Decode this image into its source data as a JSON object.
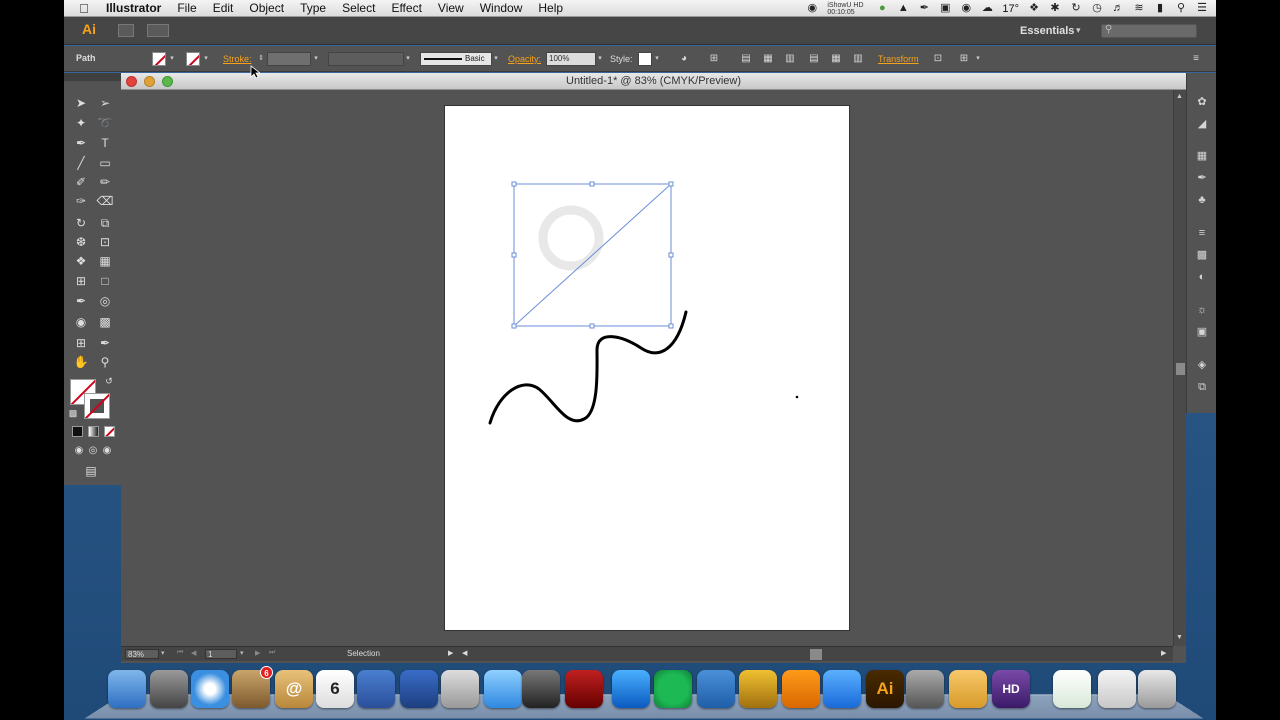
{
  "menubar": {
    "app_name": "Illustrator",
    "items": [
      "File",
      "Edit",
      "Object",
      "Type",
      "Select",
      "Effect",
      "View",
      "Window",
      "Help"
    ],
    "recorder_line1": "iShowU HD",
    "recorder_line2": "00:10:05",
    "temperature": "17°"
  },
  "appbar": {
    "logo": "Ai",
    "workspace": "Essentials"
  },
  "control_bar": {
    "selection_label": "Path",
    "stroke_label": "Stroke:",
    "brush_label": "Basic",
    "opacity_label": "Opacity:",
    "opacity_value": "100%",
    "style_label": "Style:",
    "transform_label": "Transform"
  },
  "document": {
    "title": "Untitled-1* @ 83% (CMYK/Preview)",
    "zoom": "83%",
    "artboard_number": "1",
    "status_tool": "Selection"
  },
  "dock": {
    "apps": [
      {
        "name": "finder",
        "label": ""
      },
      {
        "name": "launchpad",
        "label": ""
      },
      {
        "name": "safari",
        "label": ""
      },
      {
        "name": "mail-stamp",
        "label": "",
        "badge": "6"
      },
      {
        "name": "contacts",
        "label": "@"
      },
      {
        "name": "calendar",
        "label": "6"
      },
      {
        "name": "todo",
        "label": ""
      },
      {
        "name": "bird",
        "label": ""
      },
      {
        "name": "preview",
        "label": ""
      },
      {
        "name": "messages",
        "label": ""
      },
      {
        "name": "facetime",
        "label": ""
      },
      {
        "name": "photo-booth",
        "label": ""
      },
      {
        "name": "itunes",
        "label": ""
      },
      {
        "name": "spotify",
        "label": ""
      },
      {
        "name": "downloader",
        "label": ""
      },
      {
        "name": "crown-app",
        "label": ""
      },
      {
        "name": "ibooks",
        "label": ""
      },
      {
        "name": "app-store",
        "label": ""
      },
      {
        "name": "illustrator",
        "label": "Ai"
      },
      {
        "name": "system-preferences",
        "label": ""
      },
      {
        "name": "pages",
        "label": ""
      },
      {
        "name": "hd-app",
        "label": "HD"
      },
      {
        "name": "spreadsheet",
        "label": ""
      },
      {
        "name": "documents",
        "label": ""
      },
      {
        "name": "trash",
        "label": ""
      }
    ]
  }
}
